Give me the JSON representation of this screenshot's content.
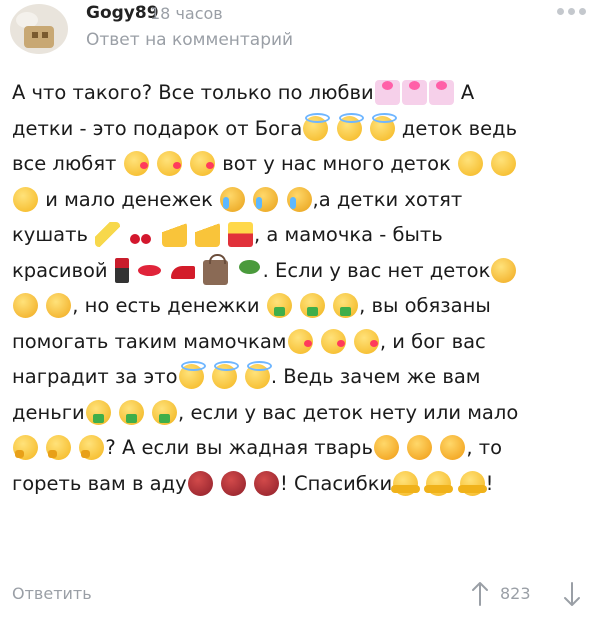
{
  "header": {
    "username": "Gogy89",
    "time": "18 часов",
    "reply_to": "Ответ на комментарий"
  },
  "comment": {
    "lines": [
      "А что такого? Все только по любви",
      "детки - это подарок от Бога",
      "все любят",
      "и мало денежек",
      "кушать",
      "красивой",
      ", но есть денежки",
      "помогать таким мамочкам",
      "наградит за это",
      "деньги",
      "? А если вы жадная тварь",
      "гореть вам в аду"
    ],
    "segments": {
      "l1_a": "А что такого? Все только по любви",
      "l1_b": "А",
      "l2_a": "детки - это подарок от Бога",
      "l2_b": "деток ведь",
      "l3_a": "все любят",
      "l3_b": "вот у нас много деток",
      "l4_a": "и мало денежек",
      "l4_b": ",а детки хотят",
      "l5_a": "кушать",
      "l5_b": ", а мамочка - быть",
      "l6_a": "красивой",
      "l6_b": ". Если у вас нет деток",
      "l7_a": ", но есть денежки",
      "l7_b": ", вы обязаны",
      "l8_a": "помогать таким мамочкам",
      "l8_b": ", и бог вас",
      "l9_a": "наградит за это",
      "l9_b": ". Ведь зачем же вам",
      "l10_a": "деньги",
      "l10_b": ", если у вас деток нету или мало",
      "l11_a": "? А если вы жадная тварь",
      "l11_b": ", то",
      "l12_a": "гореть вам в аду",
      "l12_b": "! Спасибки",
      "l12_c": "!"
    }
  },
  "footer": {
    "reply_label": "Ответить",
    "likes": "823"
  }
}
